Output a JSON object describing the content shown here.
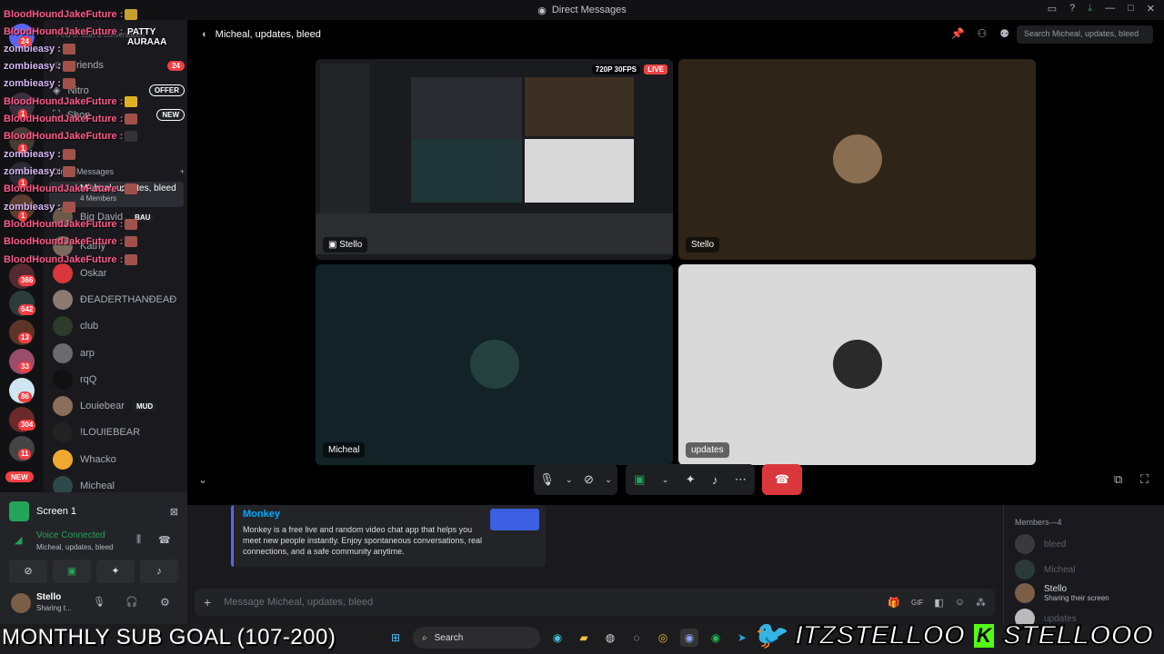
{
  "window": {
    "title": "Direct Messages"
  },
  "channel": {
    "name": "Micheal, updates, bleed",
    "search_placeholder": "Search Micheal, updates, bleed"
  },
  "dm_list": {
    "header": "PATTY AURAAA",
    "find_placeholder": "Find or start a conversation",
    "friends": "Friends",
    "friends_badge": "24",
    "nitro": "Nitro",
    "nitro_badge": "OFFER",
    "shop": "Shop",
    "shop_badge": "NEW",
    "dm_header": "Direct Messages",
    "group_name": "Micheal, updates, bleed",
    "group_members": "4 Members",
    "items": [
      {
        "name": "Big David",
        "badge": "BAU"
      },
      {
        "name": "Kathy"
      },
      {
        "name": "Oskar"
      },
      {
        "name": "ÐEADERTHANÐEAÐ"
      },
      {
        "name": "club"
      },
      {
        "name": "arp"
      },
      {
        "name": "rqQ"
      },
      {
        "name": "Louiebear",
        "badge": "MUD"
      },
      {
        "name": "!LOUIEBEAR"
      },
      {
        "name": "Whacko"
      },
      {
        "name": "Micheal"
      }
    ]
  },
  "guild_badges": [
    "24",
    "1",
    "1",
    "1",
    "1",
    "366",
    "642",
    "13",
    "33",
    "86",
    "304",
    "11",
    "NEW"
  ],
  "overlay_chat": [
    {
      "user": "BloodHoundJakeFuture :"
    },
    {
      "user": "BloodHoundJakeFuture :"
    },
    {
      "user": "zombieasy :"
    },
    {
      "user": "zombieasy :"
    },
    {
      "user": "zombieasy :"
    },
    {
      "user": "BloodHoundJakeFuture :"
    },
    {
      "user": "BloodHoundJakeFuture :"
    },
    {
      "user": "BloodHoundJakeFuture :"
    },
    {
      "user": "zombieasy :"
    },
    {
      "user": "zombieasy :"
    },
    {
      "user": "BloodHoundJakeFuture :"
    },
    {
      "user": "zombieasy :"
    },
    {
      "user": "BloodHoundJakeFuture :"
    },
    {
      "user": "BloodHoundJakeFuture :"
    },
    {
      "user": "BloodHoundJakeFuture :"
    }
  ],
  "stream": {
    "quality": "720P 30FPS",
    "live": "LIVE"
  },
  "tiles": {
    "screen": "Stello",
    "stello": "Stello",
    "micheal": "Micheal",
    "updates": "updates"
  },
  "embed": {
    "title": "Monkey",
    "description": "Monkey is a free live and random video chat app that helps you meet new people instantly. Enjoy spontaneous conversations, real connections, and a safe community anytime."
  },
  "composer": {
    "placeholder": "Message Micheal, updates, bleed"
  },
  "members": {
    "header": "Members—4",
    "list": [
      {
        "name": "bleed"
      },
      {
        "name": "Micheal"
      },
      {
        "name": "Stello",
        "status": "Sharing their screen"
      },
      {
        "name": "updates"
      }
    ]
  },
  "user_panel": {
    "screen_label": "Screen 1",
    "voice_status": "Voice Connected",
    "voice_channel": "Micheal, updates, bleed",
    "username": "Stello",
    "user_status": "Sharing t..."
  },
  "taskbar": {
    "search": "Search"
  },
  "stream_overlay": {
    "sub_goal": "MONTHLY SUB GOAL (107-200)",
    "twitter": "ITZSTELLOO",
    "kick": "STELLOOO"
  },
  "colors": {
    "accent": "#5865f2",
    "danger": "#da373c",
    "online": "#23a559",
    "live": "#ed4245"
  }
}
